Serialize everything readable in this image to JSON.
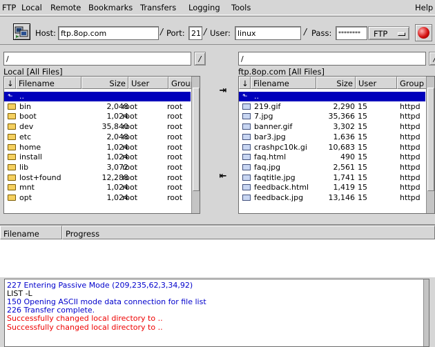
{
  "menu": {
    "ftp": "FTP",
    "local": "Local",
    "remote": "Remote",
    "bookmarks": "Bookmarks",
    "transfers": "Transfers",
    "logging": "Logging",
    "tools": "Tools",
    "help": "Help"
  },
  "toolbar": {
    "host_label": "Host:",
    "host_value": "ftp.8op.com",
    "port_label": "Port:",
    "port_value": "21",
    "user_label": "User:",
    "user_value": "linux",
    "pass_label": "Pass:",
    "pass_value": "********",
    "protocol": "FTP",
    "slash": "/"
  },
  "local": {
    "path": "/",
    "title": "Local [All Files]",
    "columns": {
      "sort": "↓",
      "filename": "Filename",
      "size": "Size",
      "user": "User",
      "group": "Group"
    },
    "rows": [
      {
        "name": "..",
        "size": "",
        "user": "",
        "group": "",
        "type": "up"
      },
      {
        "name": "bin",
        "size": "2,048",
        "user": "root",
        "group": "root",
        "type": "folder"
      },
      {
        "name": "boot",
        "size": "1,024",
        "user": "root",
        "group": "root",
        "type": "folder"
      },
      {
        "name": "dev",
        "size": "35,840",
        "user": "root",
        "group": "root",
        "type": "folder"
      },
      {
        "name": "etc",
        "size": "2,048",
        "user": "root",
        "group": "root",
        "type": "folder"
      },
      {
        "name": "home",
        "size": "1,024",
        "user": "root",
        "group": "root",
        "type": "folder"
      },
      {
        "name": "install",
        "size": "1,024",
        "user": "root",
        "group": "root",
        "type": "folder"
      },
      {
        "name": "lib",
        "size": "3,072",
        "user": "root",
        "group": "root",
        "type": "folder"
      },
      {
        "name": "lost+found",
        "size": "12,288",
        "user": "root",
        "group": "root",
        "type": "folder"
      },
      {
        "name": "mnt",
        "size": "1,024",
        "user": "root",
        "group": "root",
        "type": "folder"
      },
      {
        "name": "opt",
        "size": "1,024",
        "user": "root",
        "group": "root",
        "type": "folder"
      }
    ]
  },
  "remote": {
    "path": "/",
    "title": "ftp.8op.com [All Files]",
    "columns": {
      "sort": "↓",
      "filename": "Filename",
      "size": "Size",
      "user": "User",
      "group": "Group"
    },
    "rows": [
      {
        "name": "..",
        "size": "",
        "user": "",
        "group": "",
        "type": "up"
      },
      {
        "name": "219.gif",
        "size": "2,290",
        "user": "15",
        "group": "httpd",
        "type": "file"
      },
      {
        "name": "7.jpg",
        "size": "35,366",
        "user": "15",
        "group": "httpd",
        "type": "file"
      },
      {
        "name": "banner.gif",
        "size": "3,302",
        "user": "15",
        "group": "httpd",
        "type": "file"
      },
      {
        "name": "bar3.jpg",
        "size": "1,636",
        "user": "15",
        "group": "httpd",
        "type": "file"
      },
      {
        "name": "crashpc10k.gi",
        "size": "10,683",
        "user": "15",
        "group": "httpd",
        "type": "file"
      },
      {
        "name": "faq.html",
        "size": "490",
        "user": "15",
        "group": "httpd",
        "type": "file"
      },
      {
        "name": "faq.jpg",
        "size": "2,561",
        "user": "15",
        "group": "httpd",
        "type": "file"
      },
      {
        "name": "faqtitle.jpg",
        "size": "1,741",
        "user": "15",
        "group": "httpd",
        "type": "file"
      },
      {
        "name": "feedback.html",
        "size": "1,419",
        "user": "15",
        "group": "httpd",
        "type": "file"
      },
      {
        "name": "feedback.jpg",
        "size": "13,146",
        "user": "15",
        "group": "httpd",
        "type": "file"
      }
    ]
  },
  "transfer": {
    "upload_arrow": "⇥",
    "download_arrow": "⇤"
  },
  "queue": {
    "col_filename": "Filename",
    "col_progress": "Progress"
  },
  "log": [
    {
      "text": "227 Entering Passive Mode (209,235,62,3,34,92)",
      "color": "#0000cc"
    },
    {
      "text": "LIST -L",
      "color": "#000000"
    },
    {
      "text": "150 Opening ASCII mode data connection for file list",
      "color": "#0000cc"
    },
    {
      "text": "226 Transfer complete.",
      "color": "#0000cc"
    },
    {
      "text": "Successfully changed local directory to ..",
      "color": "#ee0000"
    },
    {
      "text": "Successfully changed local directory to ..",
      "color": "#ee0000"
    }
  ],
  "colors": {
    "selection": "#0000bb",
    "status_blue": "#0000cc",
    "status_red": "#ee0000"
  }
}
